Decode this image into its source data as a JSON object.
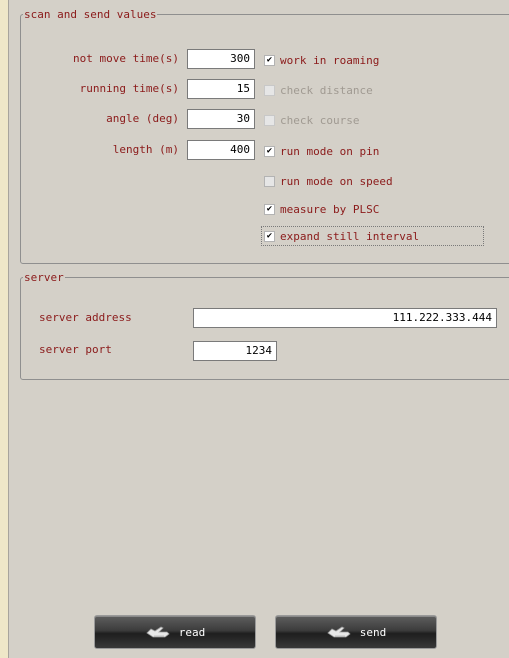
{
  "scan_group": {
    "legend": "scan and send values",
    "fields": [
      {
        "label": "not move time(s)",
        "value": "300"
      },
      {
        "label": "running time(s)",
        "value": "15"
      },
      {
        "label": "angle (deg)",
        "value": "30"
      },
      {
        "label": "length (m)",
        "value": "400"
      }
    ],
    "checkboxes": [
      {
        "label": "work in roaming",
        "checked": true,
        "enabled": true
      },
      {
        "label": "check distance",
        "checked": false,
        "enabled": false
      },
      {
        "label": "check course",
        "checked": false,
        "enabled": false
      },
      {
        "label": "run mode on pin",
        "checked": true,
        "enabled": true
      },
      {
        "label": "run mode on speed",
        "checked": false,
        "enabled": true
      },
      {
        "label": "measure by PLSC",
        "checked": true,
        "enabled": true
      },
      {
        "label": "expand still interval",
        "checked": true,
        "enabled": true
      }
    ]
  },
  "server_group": {
    "legend": "server",
    "address_label": "server address",
    "address_value": "111.222.333.444",
    "port_label": "server port",
    "port_value": "1234"
  },
  "buttons": {
    "read_label": "read",
    "send_label": "send"
  },
  "colors": {
    "label_text": "#8b1a1a",
    "background": "#d4d0c8",
    "button_dark": "#1e1e1e"
  },
  "icons": {
    "check": "checkmark-icon",
    "button": "hand-icon"
  }
}
